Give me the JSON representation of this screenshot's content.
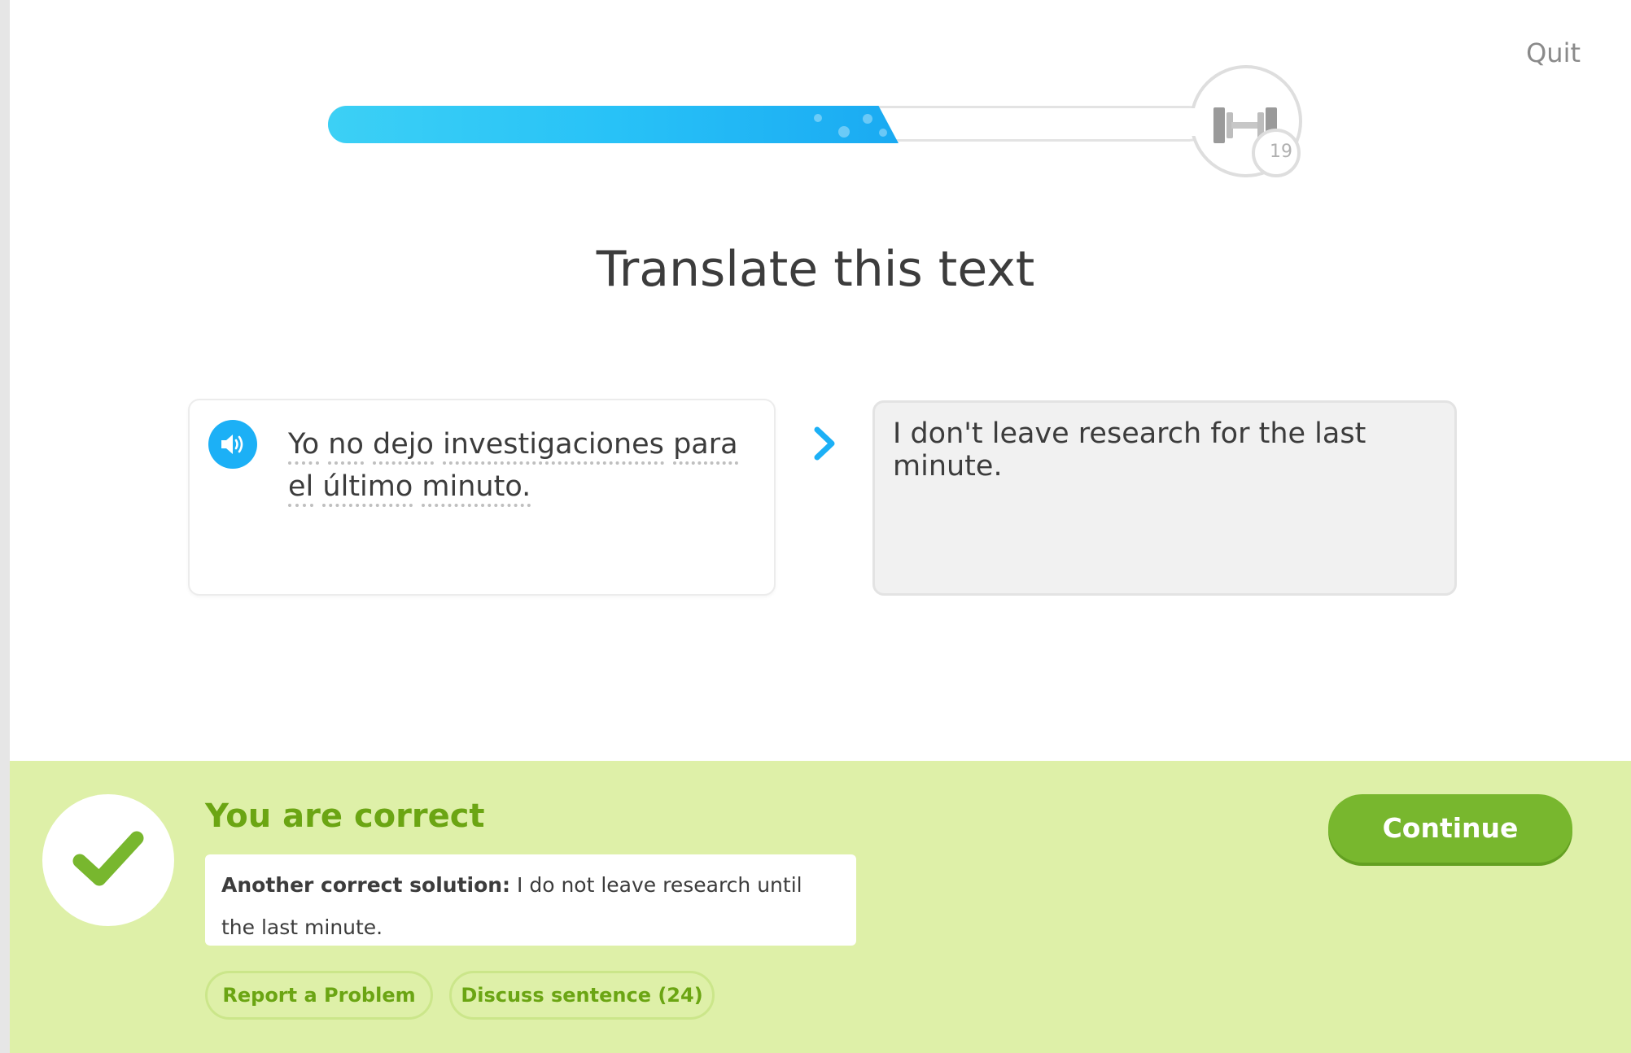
{
  "header": {
    "quit_label": "Quit",
    "progress": 0.66,
    "badge_count": "19",
    "badge_icon": "dumbbell-icon",
    "progress_color": "#1cb0f6"
  },
  "prompt": {
    "title": "Translate this text"
  },
  "source": {
    "speaker_icon": "speaker-icon",
    "words": [
      "Yo",
      "no",
      "dejo",
      "investigaciones",
      "para",
      "el",
      "último",
      "minuto."
    ]
  },
  "answer": {
    "value": "I don't leave research for the last minute."
  },
  "result": {
    "title": "You are correct",
    "solution_label": "Another correct solution:",
    "solution_text": "I do not leave research until the last minute.",
    "report_label": "Report a Problem",
    "discuss_label": "Discuss sentence (24)",
    "continue_label": "Continue",
    "accent_color": "#78b72e",
    "background_color": "#def0a8"
  }
}
